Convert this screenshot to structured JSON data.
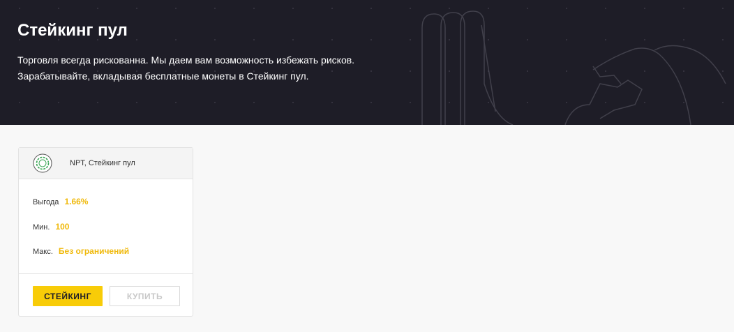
{
  "hero": {
    "title": "Стейкинг пул",
    "description_line1": "Торговля всегда рискованна. Мы даем вам возможность избежать рисков.",
    "description_line2": "Зарабатывайте, вкладывая бесплатные монеты в Стейкинг пул."
  },
  "pool_card": {
    "coin_icon": "coin-icon",
    "title": "NPT, Стейкинг пул",
    "profit_label": "Выгода",
    "profit_value": "1.66%",
    "min_label": "Мин.",
    "min_value": "100",
    "max_label": "Макс.",
    "max_value": "Без ограничений",
    "stake_button": "СТЕЙКИНГ",
    "buy_button": "КУПИТЬ"
  },
  "colors": {
    "hero_background": "#1e1d27",
    "accent": "#f8cc08",
    "value_text": "#f0b90b",
    "page_background": "#f8f8f8"
  }
}
